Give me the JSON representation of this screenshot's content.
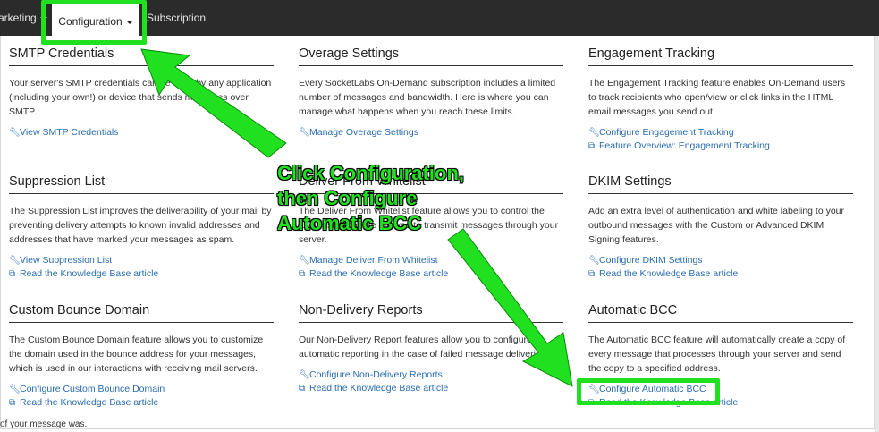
{
  "nav": {
    "items": [
      {
        "label": "arketing"
      },
      {
        "label": "Configuration"
      },
      {
        "label": "Subscription"
      }
    ]
  },
  "cards": [
    {
      "title": "SMTP Credentials",
      "description": "Your server's SMTP credentials can be used by any application (including your own!) or device that sends messages over SMTP.",
      "links": [
        {
          "icon": "wrench-icon",
          "label": "View SMTP Credentials"
        }
      ]
    },
    {
      "title": "Overage Settings",
      "description": "Every SocketLabs On-Demand subscription includes a limited number of messages and bandwidth. Here is where you can manage what happens when you reach these limits.",
      "links": [
        {
          "icon": "wrench-icon",
          "label": "Manage Overage Settings"
        }
      ]
    },
    {
      "title": "Engagement Tracking",
      "description": "The Engagement Tracking feature enables On-Demand users to track recipients who open/view or click links in the HTML email messages you send out.",
      "links": [
        {
          "icon": "wrench-icon",
          "label": "Configure Engagement Tracking"
        },
        {
          "icon": "external-link-icon",
          "label": "Feature Overview: Engagement Tracking"
        }
      ]
    },
    {
      "title": "Suppression List",
      "description": "The Suppression List improves the deliverability of your mail by preventing delivery attempts to known invalid addresses and addresses that have marked your messages as spam.",
      "links": [
        {
          "icon": "wrench-icon",
          "label": "View Suppression List"
        },
        {
          "icon": "external-link-icon",
          "label": "Read the Knowledge Base article"
        }
      ]
    },
    {
      "title": "Deliver From Whitelist",
      "description": "The Deliver From Whitelist feature allows you to control the addresses that are allowed to transmit messages through your server.",
      "links": [
        {
          "icon": "wrench-icon",
          "label": "Manage Deliver From Whitelist"
        },
        {
          "icon": "external-link-icon",
          "label": "Read the Knowledge Base article"
        }
      ]
    },
    {
      "title": "DKIM Settings",
      "description": "Add an extra level of authentication and white labeling to your outbound messages with the Custom or Advanced DKIM Signing features.",
      "links": [
        {
          "icon": "wrench-icon",
          "label": "Configure DKIM Settings"
        },
        {
          "icon": "external-link-icon",
          "label": "Read the Knowledge Base article"
        }
      ]
    },
    {
      "title": "Custom Bounce Domain",
      "description": "The Custom Bounce Domain feature allows you to customize the domain used in the bounce address for your messages, which is used in our interactions with receiving mail servers.",
      "links": [
        {
          "icon": "wrench-icon",
          "label": "Configure Custom Bounce Domain"
        },
        {
          "icon": "external-link-icon",
          "label": "Read the Knowledge Base article"
        }
      ]
    },
    {
      "title": "Non-Delivery Reports",
      "description": "Our Non-Delivery Report features allow you to configure automatic reporting in the case of failed message deliveries.",
      "links": [
        {
          "icon": "wrench-icon",
          "label": "Configure Non-Delivery Reports"
        },
        {
          "icon": "external-link-icon",
          "label": "Read the Knowledge Base article"
        }
      ]
    },
    {
      "title": "Automatic BCC",
      "description": "The Automatic BCC feature will automatically create a copy of every message that processes through your server and send the copy to a specified address.",
      "links": [
        {
          "icon": "wrench-icon",
          "label": "Configure Automatic BCC"
        },
        {
          "icon": "external-link-icon",
          "label": "Read the Knowledge Base article"
        }
      ]
    }
  ],
  "footer_text": "of your message was.",
  "annotation": "Click Configuration,\nthen Configure\nAutomatic BCC",
  "colors": {
    "highlight": "#20e020",
    "link": "#2a6cb0",
    "topbar": "#2b2b2b"
  }
}
